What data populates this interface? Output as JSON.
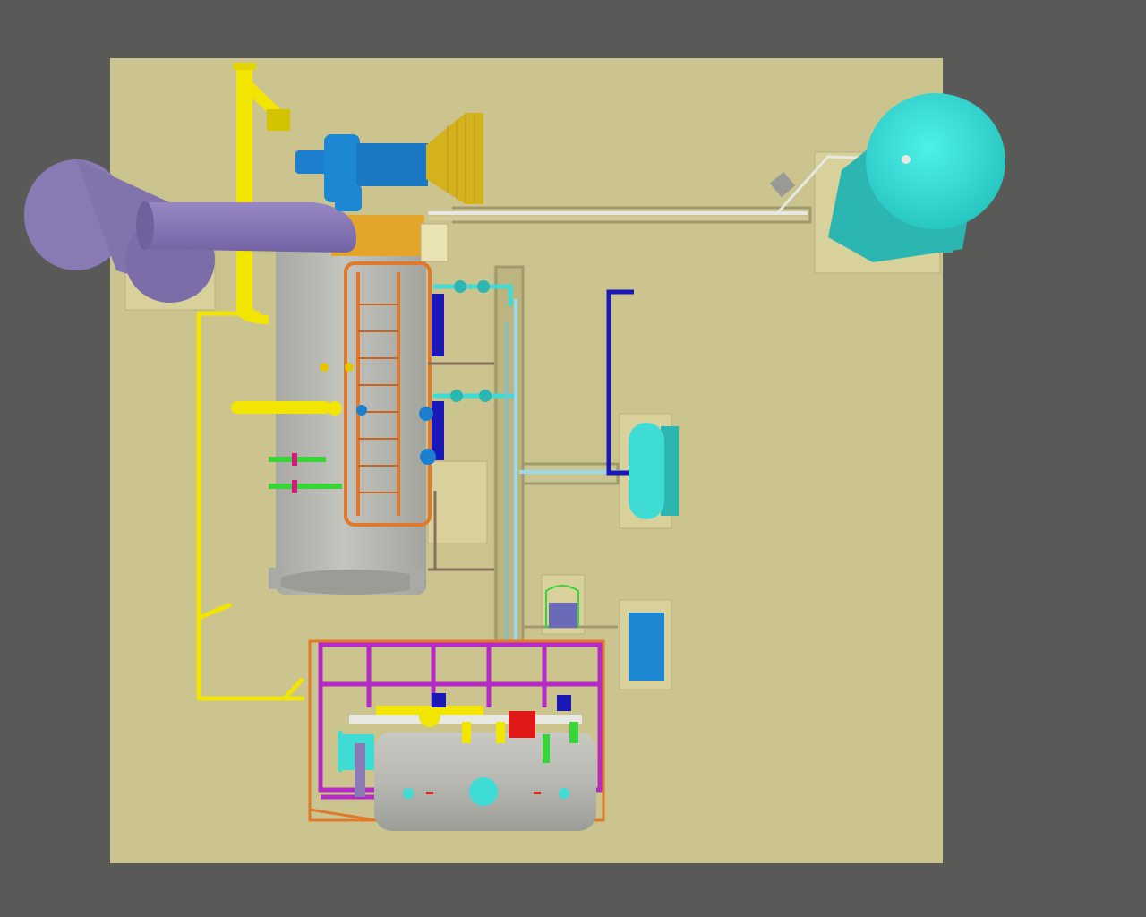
{
  "colors": {
    "background": "#595a57",
    "floor": "#cbc48f",
    "pad": "#ddd6a4",
    "boiler_shell": "#b9b9b4",
    "flue": "#8a7ab4",
    "flue_dark": "#6f629c",
    "yellow": "#f2e500",
    "cyan": "#3fdcd6",
    "cyan_dark": "#2bb6b2",
    "blue": "#1c7ecf",
    "navy": "#1b18b8",
    "orange": "#e07a2a",
    "magenta": "#b42ac4",
    "green": "#37d43a",
    "red": "#e01818",
    "brown": "#8a6f58",
    "light_blue": "#9ad8ea",
    "mustard": "#d4b21e",
    "white_pipe": "#e8e8e2"
  },
  "components": [
    {
      "name": "vertical-boiler"
    },
    {
      "name": "flue-stack"
    },
    {
      "name": "burner-assembly"
    },
    {
      "name": "water-storage-tank"
    },
    {
      "name": "horizontal-deaerator-tank"
    },
    {
      "name": "service-platform"
    },
    {
      "name": "feed-pump-pair"
    },
    {
      "name": "single-pump"
    },
    {
      "name": "control-panel"
    },
    {
      "name": "floor-trench"
    }
  ]
}
